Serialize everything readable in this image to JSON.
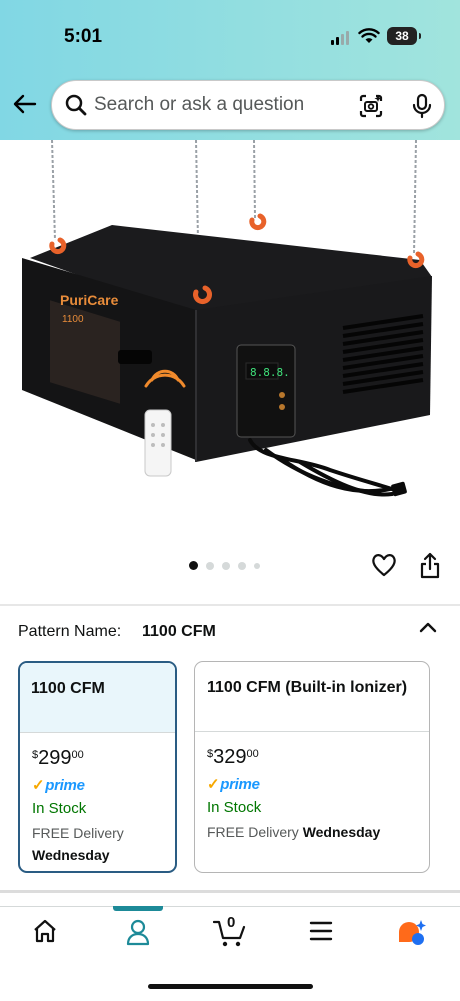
{
  "status_bar": {
    "time": "5:01",
    "battery": "38"
  },
  "search": {
    "placeholder": "Search or ask a question"
  },
  "product": {
    "image_label": "PuriCare",
    "image_sub": "1100",
    "display_readout": "8.8.8.",
    "carousel": {
      "count": 5,
      "active_index": 0
    }
  },
  "variation": {
    "label": "Pattern Name:",
    "selected": "1100 CFM",
    "options": [
      {
        "name": "1100 CFM",
        "currency": "$",
        "price_whole": "299",
        "price_fraction": "00",
        "prime": "prime",
        "stock": "In Stock",
        "delivery_prefix": "FREE Delivery",
        "delivery_day": "Wednesday"
      },
      {
        "name": "1100 CFM (Built-in lonizer)",
        "currency": "$",
        "price_whole": "329",
        "price_fraction": "00",
        "prime": "prime",
        "stock": "In Stock",
        "delivery_prefix": "FREE Delivery",
        "delivery_day": "Wednesday"
      }
    ]
  },
  "bottom_nav": {
    "cart_count": "0",
    "active": "account"
  },
  "colors": {
    "header_start": "#81d7e4",
    "header_end": "#a1e4dd",
    "selected_border": "#2a5c83",
    "in_stock": "#007600",
    "prime_blue": "#1a98ff",
    "nav_indicator": "#1d8a98"
  }
}
